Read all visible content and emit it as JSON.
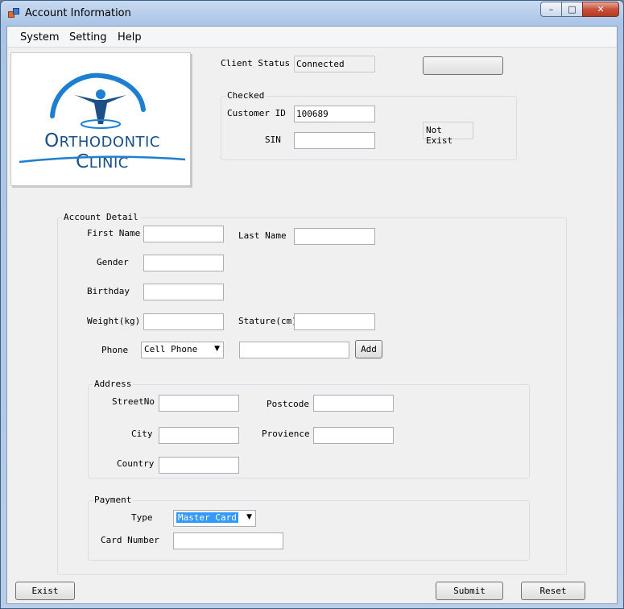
{
  "window": {
    "title": "Account Information",
    "min_glyph": "–",
    "max_glyph": "□",
    "close_glyph": "✕"
  },
  "menu": [
    "System",
    "Setting",
    "Help"
  ],
  "logo": {
    "text_o": "O",
    "text_rthodontic": "RTHODONTIC",
    "text_c": "C",
    "text_linic": "LINIC",
    "icon": "tooth-figure-icon"
  },
  "status": {
    "client_status_label": "Client Status",
    "client_status_value": "Connected",
    "status_button_label": ""
  },
  "checked": {
    "title": "Checked",
    "customer_id_label": "Customer ID",
    "customer_id_value": "100689",
    "sin_label": "SIN",
    "sin_value": "",
    "result": "Not Exist"
  },
  "account": {
    "title": "Account Detail",
    "first_name_label": "First Name",
    "first_name_value": "",
    "last_name_label": "Last Name",
    "last_name_value": "",
    "gender_label": "Gender",
    "gender_value": "",
    "birthday_label": "Birthday",
    "birthday_value": "",
    "weight_label": "Weight(kg)",
    "weight_value": "",
    "stature_label": "Stature(cm)",
    "stature_value": "",
    "phone_label": "Phone",
    "phone_type": "Cell Phone",
    "phone_value": "",
    "add_label": "Add"
  },
  "address": {
    "title": "Address",
    "street_label": "StreetNo",
    "street_value": "",
    "postcode_label": "Postcode",
    "postcode_value": "",
    "city_label": "City",
    "city_value": "",
    "province_label": "Provience",
    "province_value": "",
    "country_label": "Country",
    "country_value": ""
  },
  "payment": {
    "title": "Payment",
    "type_label": "Type",
    "type_value": "Master Card",
    "card_number_label": "Card Number",
    "card_number_value": ""
  },
  "footer": {
    "exist_label": "Exist",
    "submit_label": "Submit",
    "reset_label": "Reset"
  },
  "colors": {
    "title_bar": "#b8cde8",
    "client_bg": "#f0f0f0",
    "selection": "#3399ff",
    "logo_blue": "#1c4f86"
  }
}
